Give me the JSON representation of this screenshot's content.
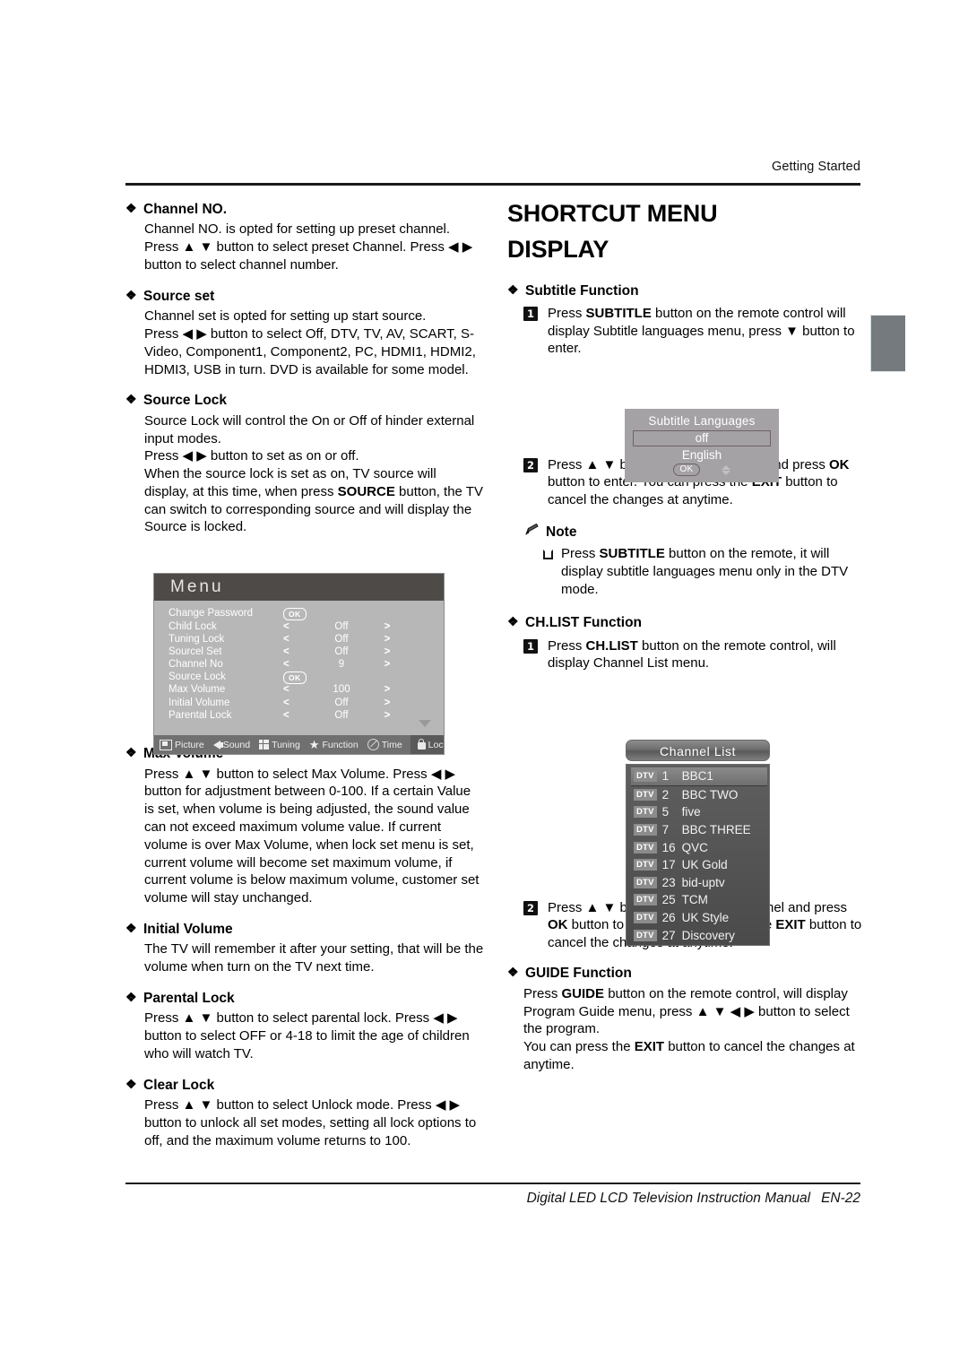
{
  "header": {
    "running_head": "Getting Started"
  },
  "footer": {
    "manual_title": "Digital LED LCD Television Instruction Manual",
    "page_number": "EN-22"
  },
  "left_column": {
    "sections": [
      {
        "heading": "Channel NO.",
        "paragraphs": [
          "Channel NO. is opted for setting up preset channel.",
          "Press ▲ ▼ button to select preset Channel. Press ◀ ▶ button to select channel number."
        ]
      },
      {
        "heading": "Source set",
        "paragraphs": [
          "Channel set is opted for setting up start source.",
          "Press ◀ ▶ button to select Off, DTV, TV, AV, SCART, S-Video, Component1, Component2, PC, HDMI1, HDMI2, HDMI3, USB in turn. DVD is available for some model."
        ]
      },
      {
        "heading": "Source Lock",
        "paragraphs": [
          "Source Lock will control the On or Off of hinder external input modes.",
          "Press ◀ ▶ button to set as on or off.",
          "When the source lock is set as on, TV source will display, at this time, when press SOURCE button, the TV can switch to corresponding source and will display the Source is locked."
        ]
      },
      {
        "heading": "Max Volume",
        "paragraphs": [
          "Press ▲ ▼ button to select Max Volume. Press ◀ ▶ button for adjustment between 0-100. If a certain Value is set, when volume is being adjusted, the sound value can not exceed maximum volume value. If current volume is over Max Volume, when lock set menu is set, current volume will become set maximum volume, if current volume is below maximum volume, customer set volume will stay unchanged."
        ]
      },
      {
        "heading": "Initial Volume",
        "paragraphs": [
          "The TV will remember it after your setting, that will be the volume when turn on the TV next time."
        ]
      },
      {
        "heading": "Parental Lock",
        "paragraphs": [
          "Press ▲ ▼ button to select parental lock. Press ◀ ▶ button to select OFF or 4-18 to limit the age of children who will watch TV."
        ]
      },
      {
        "heading": "Clear Lock",
        "paragraphs": [
          "Press ▲ ▼ button to select Unlock mode. Press ◀ ▶ button to unlock all set modes, setting all lock options to off, and the maximum volume returns to 100."
        ]
      }
    ]
  },
  "tv_menu": {
    "title": "Menu",
    "rows": [
      {
        "label": "Change Password",
        "type": "ok",
        "ok_label": "OK"
      },
      {
        "label": "Child Lock",
        "type": "spin",
        "left": "<",
        "value": "Off",
        "right": ">"
      },
      {
        "label": "Tuning Lock",
        "type": "spin",
        "left": "<",
        "value": "Off",
        "right": ">"
      },
      {
        "label": "Sourcel Set",
        "type": "spin",
        "left": "<",
        "value": "Off",
        "right": ">"
      },
      {
        "label": "Channel No",
        "type": "spin",
        "left": "<",
        "value": "9",
        "right": ">"
      },
      {
        "label": "Source Lock",
        "type": "ok",
        "ok_label": "OK"
      },
      {
        "label": "Max Volume",
        "type": "spin",
        "left": "<",
        "value": "100",
        "right": ">"
      },
      {
        "label": "Initial Volume",
        "type": "spin",
        "left": "<",
        "value": "Off",
        "right": ">"
      },
      {
        "label": "Parental Lock",
        "type": "spin",
        "left": "<",
        "value": "Off",
        "right": ">"
      }
    ],
    "tabs": [
      {
        "label": "Picture",
        "icon": "picture-icon",
        "active": false
      },
      {
        "label": "Sound",
        "icon": "speaker-icon",
        "active": false
      },
      {
        "label": "Tuning",
        "icon": "grid-icon",
        "active": false
      },
      {
        "label": "Function",
        "icon": "star-icon",
        "active": false
      },
      {
        "label": "Time",
        "icon": "clock-icon",
        "active": false
      },
      {
        "label": "Lock",
        "icon": "lock-icon",
        "active": true
      }
    ]
  },
  "right_column": {
    "title_line1": "SHORTCUT MENU",
    "title_line2": "DISPLAY",
    "subtitle_function": {
      "heading": "Subtitle Function",
      "steps": [
        {
          "num": "1",
          "text": "Press SUBTITLE button on the remote control will display Subtitle languages menu, press ▼ button to enter."
        },
        {
          "num": "2",
          "text": "Press ▲ ▼ button to select the item and press OK button to enter. You can press the EXIT button to cancel the changes at anytime."
        }
      ]
    },
    "note": {
      "heading": "Note",
      "items": [
        "Press SUBTITLE button on the remote, it will display subtitle languages menu only in the DTV mode."
      ]
    },
    "chlist_function": {
      "heading": "CH.LIST Function",
      "steps": [
        {
          "num": "1",
          "text": "Press CH.LIST button on the remote control, will display Channel List menu."
        },
        {
          "num": "2",
          "text": "Press ▲ ▼ button to select the channel and press OK button to enter. You can press the EXIT button to cancel the changes at anytime."
        }
      ]
    },
    "guide_function": {
      "heading": "GUIDE Function",
      "paragraphs": [
        "Press GUIDE button on the remote control, will display Program Guide menu, press ▲ ▼ ◀ ▶ button to select the program.",
        "You can press the EXIT button to cancel the changes at anytime."
      ]
    }
  },
  "subtitle_languages_box": {
    "title": "Subtitle Languages",
    "selected": "off",
    "option": "English",
    "ok_label": "OK"
  },
  "channel_list_box": {
    "title": "Channel List",
    "rows": [
      {
        "tag": "DTV",
        "number": "1",
        "name": "BBC1",
        "selected": true
      },
      {
        "tag": "DTV",
        "number": "2",
        "name": "BBC TWO",
        "selected": false
      },
      {
        "tag": "DTV",
        "number": "5",
        "name": "five",
        "selected": false
      },
      {
        "tag": "DTV",
        "number": "7",
        "name": "BBC THREE",
        "selected": false
      },
      {
        "tag": "DTV",
        "number": "16",
        "name": "QVC",
        "selected": false
      },
      {
        "tag": "DTV",
        "number": "17",
        "name": "UK Gold",
        "selected": false
      },
      {
        "tag": "DTV",
        "number": "23",
        "name": "bid-uptv",
        "selected": false
      },
      {
        "tag": "DTV",
        "number": "25",
        "name": "TCM",
        "selected": false
      },
      {
        "tag": "DTV",
        "number": "26",
        "name": "UK Style",
        "selected": false
      },
      {
        "tag": "DTV",
        "number": "27",
        "name": "Discovery",
        "selected": false
      }
    ]
  },
  "colors": {
    "menu_title_bar": "#4d4a48",
    "menu_body": "#b7b7b7",
    "menu_tabbar": "#707070",
    "edge_tab": "#757a7e",
    "subtitle_box": "#a5a2a5"
  }
}
